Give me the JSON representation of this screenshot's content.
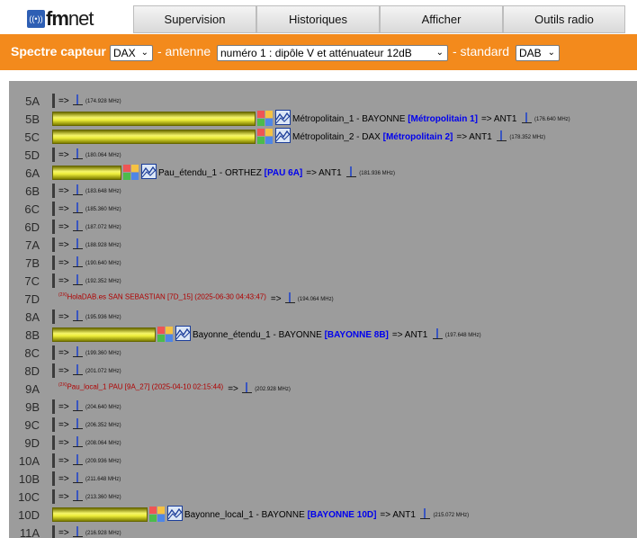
{
  "header": {
    "logo_fm": "fm",
    "logo_net": "net",
    "logo_icon": "radio-waves",
    "nav": [
      "Supervision",
      "Historiques",
      "Afficher",
      "Outils radio"
    ]
  },
  "filters": {
    "title": "Spectre capteur",
    "capteur": "DAX",
    "antenne_label": "- antenne",
    "antenne": "numéro 1 : dipôle V et atténuateur 12dB",
    "standard_label": "- standard",
    "standard": "DAB"
  },
  "channels": [
    {
      "ch": "5A",
      "arrow": "=>",
      "freq": "(174.928 MHz)"
    },
    {
      "ch": "5B",
      "level": 1.0,
      "name": "Métropolitain_1 - BAYONNE",
      "mux": "[Métropolitain 1]",
      "ant": "=> ANT1",
      "freq": "(176.640 MHz)"
    },
    {
      "ch": "5C",
      "level": 1.0,
      "name": "Métropolitain_2 - DAX",
      "mux": "[Métropolitain 2]",
      "ant": "=> ANT1",
      "freq": "(178.352 MHz)"
    },
    {
      "ch": "5D",
      "arrow": "=>",
      "freq": "(180.064 MHz)"
    },
    {
      "ch": "6A",
      "level": 0.34,
      "name": "Pau_étendu_1 - ORTHEZ",
      "mux": "[PAU 6A]",
      "ant": "=> ANT1",
      "freq": "(181.936 MHz)"
    },
    {
      "ch": "6B",
      "arrow": "=>",
      "freq": "(183.648 MHz)"
    },
    {
      "ch": "6C",
      "arrow": "=>",
      "freq": "(185.360 MHz)"
    },
    {
      "ch": "6D",
      "arrow": "=>",
      "freq": "(187.072 MHz)"
    },
    {
      "ch": "7A",
      "arrow": "=>",
      "freq": "(188.928 MHz)"
    },
    {
      "ch": "7B",
      "arrow": "=>",
      "freq": "(190.640 MHz)"
    },
    {
      "ch": "7C",
      "arrow": "=>",
      "freq": "(192.352 MHz)"
    },
    {
      "ch": "7D",
      "sup": "(2X)",
      "red": "HolaDAB.es SAN SEBASTIAN [7D_15] (2025-06-30 04:43:47)",
      "arrow": "=>",
      "freq": "(194.064 MHz)"
    },
    {
      "ch": "8A",
      "arrow": "=>",
      "freq": "(195.936 MHz)"
    },
    {
      "ch": "8B",
      "level": 0.51,
      "name": "Bayonne_étendu_1 - BAYONNE",
      "mux": "[BAYONNE 8B]",
      "ant": "=> ANT1",
      "freq": "(197.648 MHz)"
    },
    {
      "ch": "8C",
      "arrow": "=>",
      "freq": "(199.360 MHz)"
    },
    {
      "ch": "8D",
      "arrow": "=>",
      "freq": "(201.072 MHz)"
    },
    {
      "ch": "9A",
      "sup": "(2X)",
      "red": "Pau_local_1 PAU [9A_27] (2025-04-10 02:15:44)",
      "arrow": "=>",
      "freq": "(202.928 MHz)"
    },
    {
      "ch": "9B",
      "arrow": "=>",
      "freq": "(204.640 MHz)"
    },
    {
      "ch": "9C",
      "arrow": "=>",
      "freq": "(206.352 MHz)"
    },
    {
      "ch": "9D",
      "arrow": "=>",
      "freq": "(208.064 MHz)"
    },
    {
      "ch": "10A",
      "arrow": "=>",
      "freq": "(209.936 MHz)"
    },
    {
      "ch": "10B",
      "arrow": "=>",
      "freq": "(211.648 MHz)"
    },
    {
      "ch": "10C",
      "arrow": "=>",
      "freq": "(213.360 MHz)"
    },
    {
      "ch": "10D",
      "level": 0.47,
      "name": "Bayonne_local_1 - BAYONNE",
      "mux": "[BAYONNE 10D]",
      "ant": "=> ANT1",
      "freq": "(215.072 MHz)"
    },
    {
      "ch": "11A",
      "arrow": "=>",
      "freq": "(216.928 MHz)"
    }
  ],
  "colors": {
    "orange": "#f38a1c",
    "panel": "#9c9c9c",
    "link": "#0000ee",
    "alert": "#b00000",
    "bar": "#ecec3a"
  }
}
